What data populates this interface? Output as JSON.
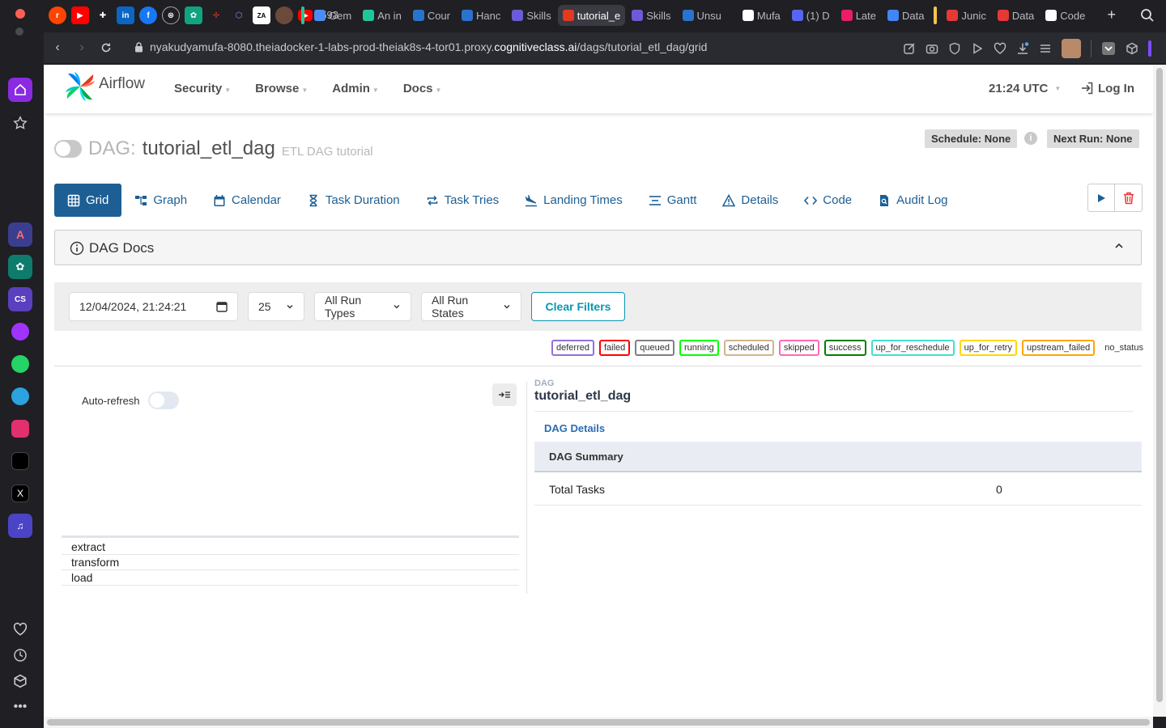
{
  "browser": {
    "pinned_tab_label": "(593",
    "tabs": [
      {
        "label": "Gem",
        "color": "#4b8bf5"
      },
      {
        "label": "An in",
        "color": "#22c59a"
      },
      {
        "label": "Cour",
        "color": "#2a73cc"
      },
      {
        "label": "Hanc",
        "color": "#2a73cc"
      },
      {
        "label": "Skills",
        "color": "#6b5bd6"
      },
      {
        "label": "tutorial_e",
        "color": "#e43921",
        "active": true
      },
      {
        "label": "Skills",
        "color": "#6b5bd6"
      },
      {
        "label": "Unsu",
        "color": "#2a73cc"
      },
      {
        "label": "Mufa",
        "color": "#ffffff"
      },
      {
        "label": "(1) D",
        "color": "#5865f2"
      },
      {
        "label": "Late",
        "color": "#e91e63"
      },
      {
        "label": "Data",
        "color": "#4285f4"
      },
      {
        "label": "Junic",
        "color": "#e53935"
      },
      {
        "label": "Data",
        "color": "#e53935"
      },
      {
        "label": "Code",
        "color": "#ffffff"
      }
    ],
    "url_prefix": "nyakudyamufa-8080.theiadocker-1-labs-prod-theiak8s-4-tor01.proxy.",
    "url_host": "cognitiveclass.ai",
    "url_path": "/dags/tutorial_etl_dag/grid"
  },
  "nav": {
    "logo_text": "Airflow",
    "menu": [
      "Security",
      "Browse",
      "Admin",
      "Docs"
    ],
    "time": "21:24 UTC",
    "login": "Log In"
  },
  "dag": {
    "prefix": "DAG:",
    "name": "tutorial_etl_dag",
    "description": "ETL DAG tutorial",
    "schedule": "Schedule: None",
    "next_run": "Next Run: None"
  },
  "view_tabs": [
    "Grid",
    "Graph",
    "Calendar",
    "Task Duration",
    "Task Tries",
    "Landing Times",
    "Gantt",
    "Details",
    "Code",
    "Audit Log"
  ],
  "docs_panel": {
    "title": "DAG Docs"
  },
  "filters": {
    "date": "12/04/2024, 21:24:21",
    "num_runs": "25",
    "run_types": "All Run Types",
    "run_states": "All Run States",
    "clear": "Clear Filters"
  },
  "legend": [
    {
      "label": "deferred",
      "color": "#9370db"
    },
    {
      "label": "failed",
      "color": "#ff0000"
    },
    {
      "label": "queued",
      "color": "#808080"
    },
    {
      "label": "running",
      "color": "#00ff00"
    },
    {
      "label": "scheduled",
      "color": "#d2b48c"
    },
    {
      "label": "skipped",
      "color": "#ff69b4"
    },
    {
      "label": "success",
      "color": "#008000"
    },
    {
      "label": "up_for_reschedule",
      "color": "#40e0d0"
    },
    {
      "label": "up_for_retry",
      "color": "#ffd700"
    },
    {
      "label": "upstream_failed",
      "color": "#ffa500"
    },
    {
      "label": "no_status",
      "color": ""
    }
  ],
  "grid": {
    "auto_refresh": "Auto-refresh",
    "tasks": [
      "extract",
      "transform",
      "load"
    ]
  },
  "details": {
    "label": "DAG",
    "name": "tutorial_etl_dag",
    "link": "DAG Details",
    "summary_title": "DAG Summary",
    "rows": [
      {
        "key": "Total Tasks",
        "value": "0"
      }
    ]
  }
}
